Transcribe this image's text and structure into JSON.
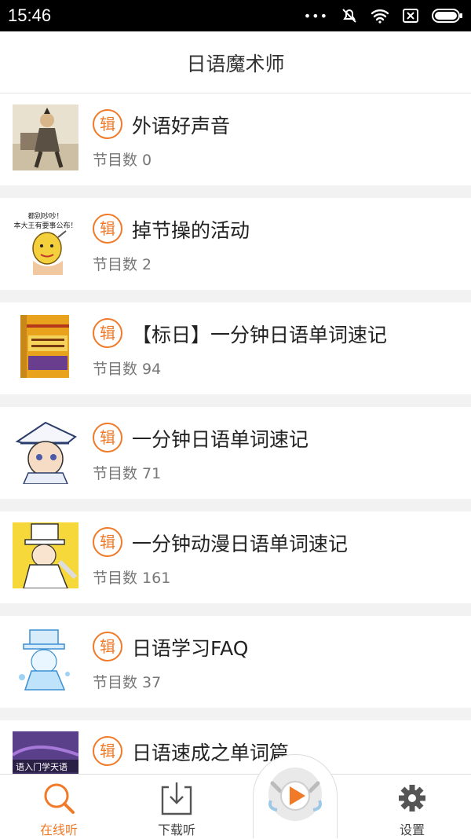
{
  "status": {
    "time": "15:46"
  },
  "header": {
    "title": "日语魔术师"
  },
  "badge_label": "辑",
  "count_label": "节目数",
  "albums": [
    {
      "title": "外语好声音",
      "count": "0"
    },
    {
      "title": "掉节操的活动",
      "count": "2"
    },
    {
      "title": "【标日】一分钟日语单词速记",
      "count": "94"
    },
    {
      "title": "一分钟日语单词速记",
      "count": "71"
    },
    {
      "title": "一分钟动漫日语单词速记",
      "count": "161"
    },
    {
      "title": "日语学习FAQ",
      "count": "37"
    },
    {
      "title": "日语速成之单词篇",
      "count": ""
    }
  ],
  "thumb_texts": {
    "album2_line1": "都别吵吵！",
    "album2_line2": "本大王有要事公布！",
    "album7_text": "语入门学天语"
  },
  "tabs": {
    "online": "在线听",
    "download": "下载听",
    "settings": "设置"
  },
  "colors": {
    "accent": "#f07a28",
    "background": "#f2f2f2",
    "statusbar": "#000000"
  },
  "icons": [
    "wifi-icon",
    "mute-icon",
    "sim-icon",
    "battery-icon",
    "search-icon",
    "download-icon",
    "play-icon",
    "gear-icon"
  ]
}
